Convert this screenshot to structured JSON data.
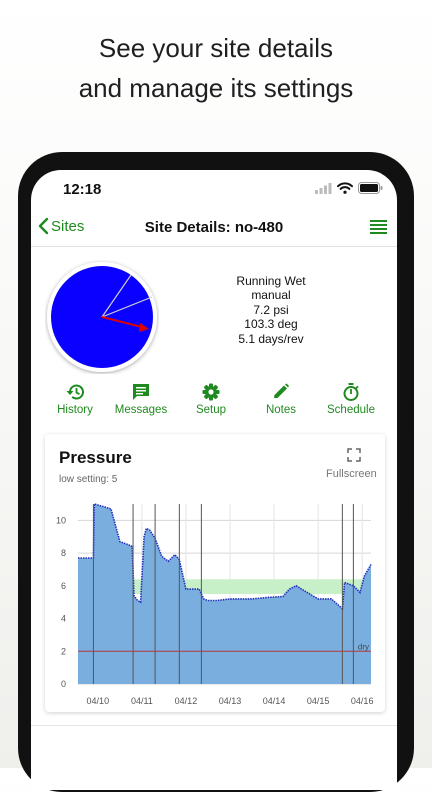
{
  "promo": {
    "line1": "See your site details",
    "line2": "and manage its settings"
  },
  "status_bar": {
    "time": "12:18"
  },
  "nav": {
    "back_label": "Sites",
    "title": "Site Details: no-480"
  },
  "site_status": {
    "state": "Running Wet",
    "mode": "manual",
    "pressure": "7.2 psi",
    "angle": "103.3 deg",
    "rate": "5.1 days/rev"
  },
  "gauge": {
    "fill_color": "#0a00ff",
    "needle_color": "#e00000"
  },
  "actions": [
    {
      "label": "History",
      "icon": "history-icon"
    },
    {
      "label": "Messages",
      "icon": "message-icon"
    },
    {
      "label": "Setup",
      "icon": "gear-icon"
    },
    {
      "label": "Notes",
      "icon": "pencil-icon"
    },
    {
      "label": "Schedule",
      "icon": "stopwatch-icon"
    }
  ],
  "accent_color": "#1f8a1f",
  "chart_card": {
    "title": "Pressure",
    "subtitle": "low setting: 5",
    "fullscreen_label": "Fullscreen"
  },
  "chart_data": {
    "type": "area",
    "title": "Pressure",
    "xlabel": "",
    "ylabel": "",
    "ylim": [
      0,
      11
    ],
    "yticks": [
      0,
      2,
      4,
      6,
      8,
      10
    ],
    "xlim": [
      9.55,
      16.2
    ],
    "xtick_labels": [
      "04/10",
      "04/11",
      "04/12",
      "04/13",
      "04/14",
      "04/15",
      "04/16"
    ],
    "xtick_values": [
      10,
      11,
      12,
      13,
      14,
      15,
      16
    ],
    "event_lines": [
      9.9,
      10.8,
      11.3,
      11.85,
      12.35,
      15.55,
      15.8
    ],
    "reference_line": {
      "value": 2,
      "label": "dry",
      "color": "#b23a3a"
    },
    "band": {
      "from": 5.5,
      "to": 6.4,
      "start": 10.05,
      "end": 16.2,
      "color": "#c8f0c8"
    },
    "grid": true,
    "fill_color": "#7aaede",
    "series": [
      {
        "x": [
          9.55,
          9.9,
          9.92,
          10.05,
          10.3,
          10.5,
          10.7,
          10.78,
          10.82,
          10.9,
          10.97,
          11.0,
          11.05,
          11.1,
          11.18,
          11.3,
          11.45,
          11.6,
          11.75,
          11.85,
          12.0,
          12.3,
          12.4,
          12.5,
          12.7,
          13.0,
          13.5,
          13.9,
          14.2,
          14.35,
          14.5,
          14.75,
          15.0,
          15.3,
          15.55,
          15.6,
          15.8,
          15.95,
          16.05,
          16.2
        ],
        "y": [
          7.7,
          7.7,
          11.0,
          10.9,
          10.7,
          8.7,
          8.5,
          8.4,
          5.4,
          5.1,
          5.0,
          6.5,
          9.0,
          9.5,
          9.4,
          8.9,
          7.8,
          7.5,
          7.9,
          7.6,
          5.8,
          5.8,
          5.2,
          5.1,
          5.1,
          5.2,
          5.2,
          5.3,
          5.35,
          5.8,
          6.0,
          5.6,
          5.2,
          5.2,
          4.6,
          6.2,
          6.0,
          5.6,
          6.6,
          7.3
        ]
      }
    ]
  }
}
